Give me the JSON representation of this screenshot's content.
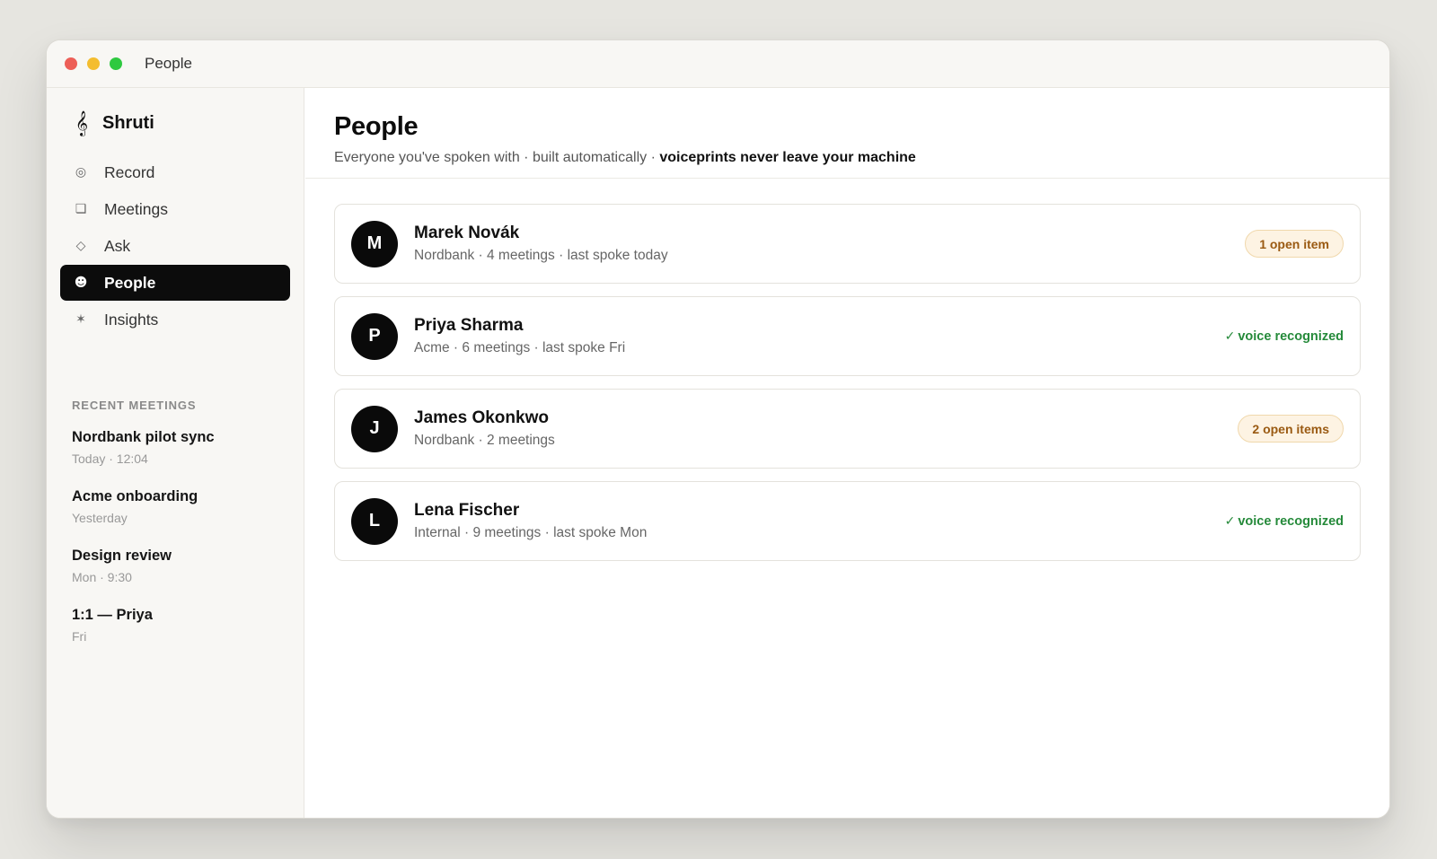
{
  "window": {
    "title": "People"
  },
  "sidebar": {
    "brand": {
      "icon": "treble-clef-icon",
      "glyph": "𝄞",
      "name": "Shruti"
    },
    "nav": [
      {
        "label": "Record",
        "icon": "record-icon",
        "glyph": "◎",
        "active": false
      },
      {
        "label": "Meetings",
        "icon": "meetings-icon",
        "glyph": "❏",
        "active": false
      },
      {
        "label": "Ask",
        "icon": "ask-icon",
        "glyph": "◇",
        "active": false
      },
      {
        "label": "People",
        "icon": "people-icon",
        "glyph": "☻",
        "active": true
      },
      {
        "label": "Insights",
        "icon": "insights-icon",
        "glyph": "✶",
        "active": false
      }
    ],
    "recent_heading": "RECENT MEETINGS",
    "recent": [
      {
        "title": "Nordbank pilot sync",
        "sub": "Today · 12:04"
      },
      {
        "title": "Acme onboarding",
        "sub": "Yesterday"
      },
      {
        "title": "Design review",
        "sub": "Mon · 9:30"
      },
      {
        "title": "1:1 — Priya",
        "sub": "Fri"
      }
    ]
  },
  "main": {
    "title": "People",
    "subtitle": {
      "plain": "Everyone you've spoken with · built automatically · ",
      "strong": "voiceprints never leave your machine"
    },
    "people": [
      {
        "initial": "M",
        "name": "Marek Novák",
        "meta": "Nordbank · 4 meetings · last spoke today",
        "status_type": "badge",
        "status": "1 open item"
      },
      {
        "initial": "P",
        "name": "Priya Sharma",
        "meta": "Acme · 6 meetings · last spoke Fri",
        "status_type": "voice",
        "status": "voice recognized"
      },
      {
        "initial": "J",
        "name": "James Okonkwo",
        "meta": "Nordbank · 2 meetings",
        "status_type": "badge",
        "status": "2 open items"
      },
      {
        "initial": "L",
        "name": "Lena Fischer",
        "meta": "Internal · 9 meetings · last spoke Mon",
        "status_type": "voice",
        "status": "voice recognized"
      }
    ],
    "voice_check_glyph": "✓"
  },
  "colors": {
    "accent": "#0c0c0c",
    "badge_bg": "#fdf3e3",
    "badge_text": "#9a5a12",
    "voice_green": "#258a3a"
  }
}
